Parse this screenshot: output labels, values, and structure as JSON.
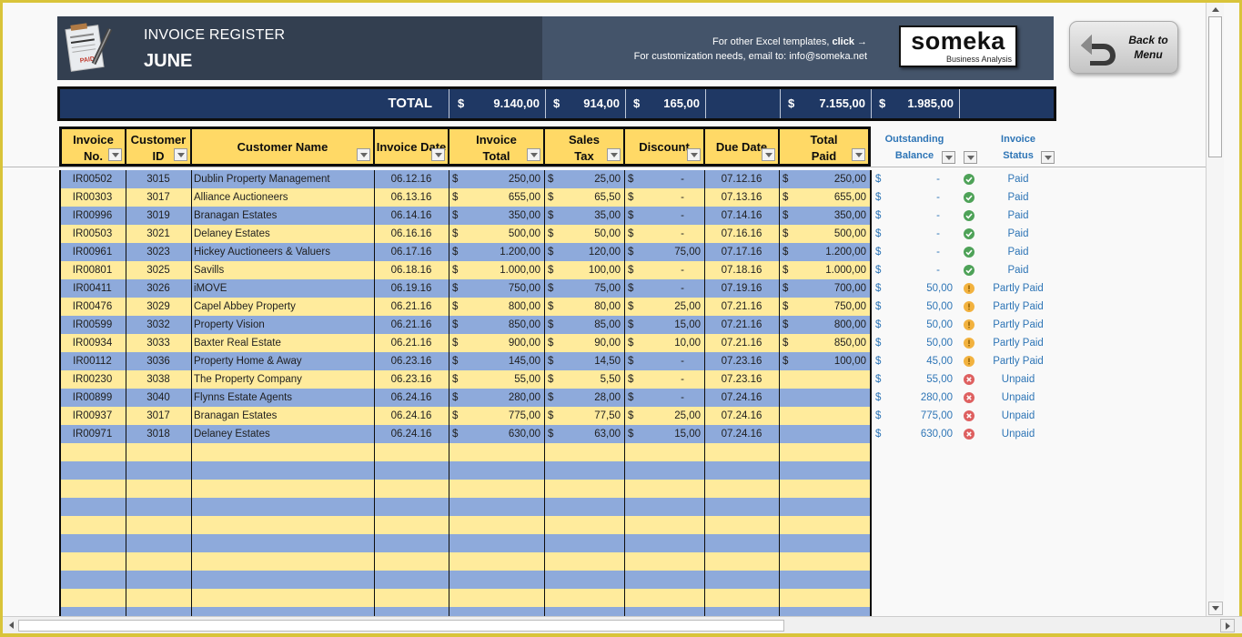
{
  "banner": {
    "title": "INVOICE REGISTER",
    "month": "JUNE",
    "link_text_prefix": "For other Excel templates, ",
    "link_text_click": "click →",
    "email_line": "For customization needs, email to: info@someka.net",
    "brand": "someka",
    "brand_sub": "Business Analysis",
    "back_button": "Back to Menu",
    "back_button_line1": "Back to",
    "back_button_line2": "Menu"
  },
  "totals": {
    "label": "TOTAL",
    "currency": "$",
    "invoice_total": "9.140,00",
    "sales_tax": "914,00",
    "discount": "165,00",
    "total_paid": "7.155,00",
    "outstanding_balance": "1.985,00"
  },
  "headers": {
    "invoice_no_1": "Invoice",
    "invoice_no_2": "No.",
    "customer_id_1": "Customer",
    "customer_id_2": "ID",
    "customer_name": "Customer Name",
    "invoice_date": "Invoice Date",
    "invoice_total_1": "Invoice",
    "invoice_total_2": "Total",
    "sales_tax_1": "Sales",
    "sales_tax_2": "Tax",
    "discount": "Discount",
    "due_date": "Due Date",
    "total_paid_1": "Total",
    "total_paid_2": "Paid",
    "outstanding_1": "Outstanding",
    "outstanding_2": "Balance",
    "status_1": "Invoice",
    "status_2": "Status"
  },
  "rows": [
    {
      "invoice_no": "IR00502",
      "customer_id": "3015",
      "customer_name": "Dublin Property Management",
      "invoice_date": "06.12.16",
      "invoice_total": "250,00",
      "sales_tax": "25,00",
      "discount": "-",
      "due_date": "07.12.16",
      "total_paid": "250,00",
      "outstanding": "-",
      "status": "Paid",
      "status_icon": "check-icon"
    },
    {
      "invoice_no": "IR00303",
      "customer_id": "3017",
      "customer_name": "Alliance Auctioneers",
      "invoice_date": "06.13.16",
      "invoice_total": "655,00",
      "sales_tax": "65,50",
      "discount": "-",
      "due_date": "07.13.16",
      "total_paid": "655,00",
      "outstanding": "-",
      "status": "Paid",
      "status_icon": "check-icon"
    },
    {
      "invoice_no": "IR00996",
      "customer_id": "3019",
      "customer_name": "Branagan Estates",
      "invoice_date": "06.14.16",
      "invoice_total": "350,00",
      "sales_tax": "35,00",
      "discount": "-",
      "due_date": "07.14.16",
      "total_paid": "350,00",
      "outstanding": "-",
      "status": "Paid",
      "status_icon": "check-icon"
    },
    {
      "invoice_no": "IR00503",
      "customer_id": "3021",
      "customer_name": "Delaney Estates",
      "invoice_date": "06.16.16",
      "invoice_total": "500,00",
      "sales_tax": "50,00",
      "discount": "-",
      "due_date": "07.16.16",
      "total_paid": "500,00",
      "outstanding": "-",
      "status": "Paid",
      "status_icon": "check-icon"
    },
    {
      "invoice_no": "IR00961",
      "customer_id": "3023",
      "customer_name": "Hickey Auctioneers & Valuers",
      "invoice_date": "06.17.16",
      "invoice_total": "1.200,00",
      "sales_tax": "120,00",
      "discount": "75,00",
      "due_date": "07.17.16",
      "total_paid": "1.200,00",
      "outstanding": "-",
      "status": "Paid",
      "status_icon": "check-icon"
    },
    {
      "invoice_no": "IR00801",
      "customer_id": "3025",
      "customer_name": "Savills",
      "invoice_date": "06.18.16",
      "invoice_total": "1.000,00",
      "sales_tax": "100,00",
      "discount": "-",
      "due_date": "07.18.16",
      "total_paid": "1.000,00",
      "outstanding": "-",
      "status": "Paid",
      "status_icon": "check-icon"
    },
    {
      "invoice_no": "IR00411",
      "customer_id": "3026",
      "customer_name": "iMOVE",
      "invoice_date": "06.19.16",
      "invoice_total": "750,00",
      "sales_tax": "75,00",
      "discount": "-",
      "due_date": "07.19.16",
      "total_paid": "700,00",
      "outstanding": "50,00",
      "status": "Partly Paid",
      "status_icon": "warning-icon"
    },
    {
      "invoice_no": "IR00476",
      "customer_id": "3029",
      "customer_name": "Capel Abbey Property",
      "invoice_date": "06.21.16",
      "invoice_total": "800,00",
      "sales_tax": "80,00",
      "discount": "25,00",
      "due_date": "07.21.16",
      "total_paid": "750,00",
      "outstanding": "50,00",
      "status": "Partly Paid",
      "status_icon": "warning-icon"
    },
    {
      "invoice_no": "IR00599",
      "customer_id": "3032",
      "customer_name": "Property Vision",
      "invoice_date": "06.21.16",
      "invoice_total": "850,00",
      "sales_tax": "85,00",
      "discount": "15,00",
      "due_date": "07.21.16",
      "total_paid": "800,00",
      "outstanding": "50,00",
      "status": "Partly Paid",
      "status_icon": "warning-icon"
    },
    {
      "invoice_no": "IR00934",
      "customer_id": "3033",
      "customer_name": "Baxter Real Estate",
      "invoice_date": "06.21.16",
      "invoice_total": "900,00",
      "sales_tax": "90,00",
      "discount": "10,00",
      "due_date": "07.21.16",
      "total_paid": "850,00",
      "outstanding": "50,00",
      "status": "Partly Paid",
      "status_icon": "warning-icon"
    },
    {
      "invoice_no": "IR00112",
      "customer_id": "3036",
      "customer_name": "Property Home & Away",
      "invoice_date": "06.23.16",
      "invoice_total": "145,00",
      "sales_tax": "14,50",
      "discount": "-",
      "due_date": "07.23.16",
      "total_paid": "100,00",
      "outstanding": "45,00",
      "status": "Partly Paid",
      "status_icon": "warning-icon"
    },
    {
      "invoice_no": "IR00230",
      "customer_id": "3038",
      "customer_name": "The Property Company",
      "invoice_date": "06.23.16",
      "invoice_total": "55,00",
      "sales_tax": "5,50",
      "discount": "-",
      "due_date": "07.23.16",
      "total_paid": "",
      "outstanding": "55,00",
      "status": "Unpaid",
      "status_icon": "cross-icon"
    },
    {
      "invoice_no": "IR00899",
      "customer_id": "3040",
      "customer_name": "Flynns Estate Agents",
      "invoice_date": "06.24.16",
      "invoice_total": "280,00",
      "sales_tax": "28,00",
      "discount": "-",
      "due_date": "07.24.16",
      "total_paid": "",
      "outstanding": "280,00",
      "status": "Unpaid",
      "status_icon": "cross-icon"
    },
    {
      "invoice_no": "IR00937",
      "customer_id": "3017",
      "customer_name": "Branagan Estates",
      "invoice_date": "06.24.16",
      "invoice_total": "775,00",
      "sales_tax": "77,50",
      "discount": "25,00",
      "due_date": "07.24.16",
      "total_paid": "",
      "outstanding": "775,00",
      "status": "Unpaid",
      "status_icon": "cross-icon"
    },
    {
      "invoice_no": "IR00971",
      "customer_id": "3018",
      "customer_name": "Delaney Estates",
      "invoice_date": "06.24.16",
      "invoice_total": "630,00",
      "sales_tax": "63,00",
      "discount": "15,00",
      "due_date": "07.24.16",
      "total_paid": "",
      "outstanding": "630,00",
      "status": "Unpaid",
      "status_icon": "cross-icon"
    }
  ],
  "empty_rows": 10,
  "currency": "$",
  "colors": {
    "banner_dark": "#333f50",
    "banner_light": "#44546a",
    "total_bar": "#1f3864",
    "header_yellow": "#ffd966",
    "row_blue": "#8eaadb",
    "row_yellow": "#ffeb9c",
    "status_text": "#2e75b6",
    "paid_icon": "#4ea258",
    "partly_icon": "#f2b23f",
    "unpaid_icon": "#de6060"
  }
}
